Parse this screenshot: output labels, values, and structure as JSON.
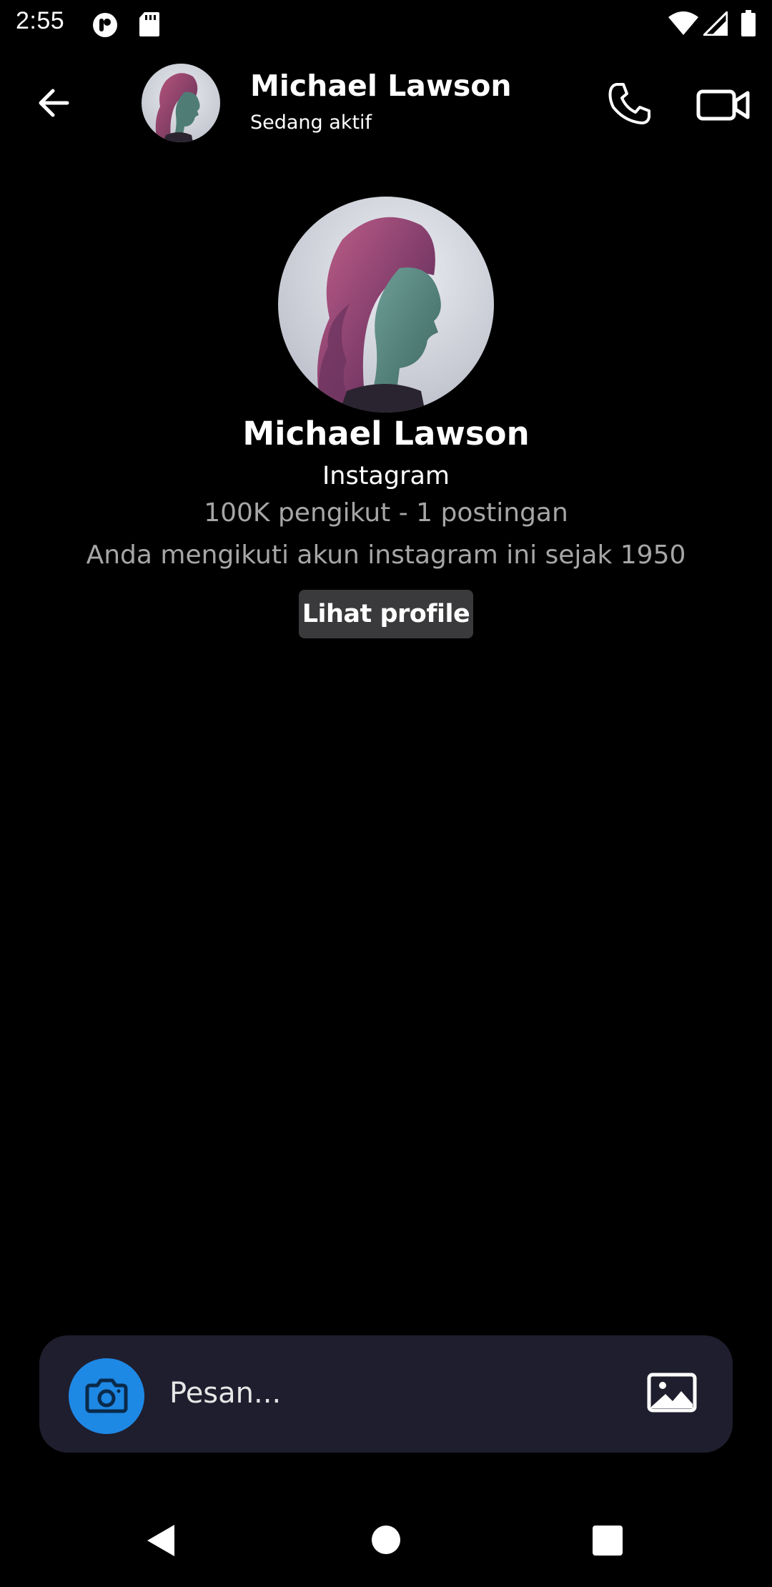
{
  "status_bar": {
    "time": "2:55",
    "icons": [
      "notification-app-icon",
      "sd-card-icon",
      "wifi-icon",
      "signal-icon",
      "battery-icon"
    ]
  },
  "header": {
    "contact_name": "Michael Lawson",
    "status": "Sedang aktif",
    "icons": {
      "back": "back-arrow-icon",
      "call": "phone-icon",
      "video": "video-camera-icon"
    }
  },
  "profile": {
    "name": "Michael Lawson",
    "source": "Instagram",
    "stats": "100K pengikut - 1 postingan",
    "follow_info": "Anda mengikuti akun instagram ini sejak 1950",
    "view_profile_label": "Lihat profile"
  },
  "composer": {
    "placeholder": "Pesan...",
    "value": "",
    "icons": {
      "camera": "camera-icon",
      "gallery": "image-gallery-icon"
    }
  },
  "nav_bar": {
    "icons": [
      "nav-back-icon",
      "nav-home-icon",
      "nav-recents-icon"
    ]
  },
  "colors": {
    "background": "#000000",
    "composer_bg": "#1f1e2e",
    "camera_button": "#1e88e5",
    "button_bg": "#3a3a3c",
    "secondary_text": "#a6a6a6"
  }
}
